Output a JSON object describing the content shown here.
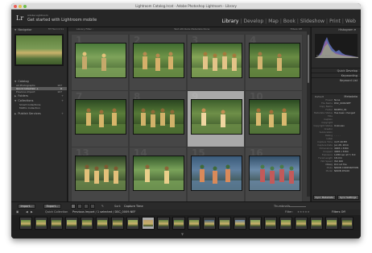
{
  "window": {
    "title": "Lightroom Catalog.lrcat - Adobe Photoshop Lightroom - Library",
    "traffic_colors": [
      "#ec5f57",
      "#e2c14c",
      "#6fbe4a"
    ]
  },
  "identity": {
    "logo": "Lr",
    "small_text": "Adobe Lightroom",
    "big_text": "Get started with Lightroom mobile"
  },
  "modules": [
    {
      "label": "Library",
      "active": true
    },
    {
      "label": "Develop",
      "active": false
    },
    {
      "label": "Map",
      "active": false
    },
    {
      "label": "Book",
      "active": false
    },
    {
      "label": "Slideshow",
      "active": false
    },
    {
      "label": "Print",
      "active": false
    },
    {
      "label": "Web",
      "active": false
    }
  ],
  "left_panel": {
    "navigator_label": "Navigator",
    "navigator_zoom": "FIT  FILL  1:1  3:1",
    "catalog_label": "Catalog",
    "catalog_items": [
      {
        "label": "All Photographs",
        "count": "107",
        "selected": false
      },
      {
        "label": "Quick Collection +",
        "count": "0",
        "selected": true
      },
      {
        "label": "Previous Import",
        "count": "107",
        "selected": false
      }
    ],
    "folders_label": "Folders",
    "collections_label": "Collections",
    "collection_items": [
      {
        "label": "Smart Collections"
      },
      {
        "label": "MoPho Collection"
      }
    ],
    "publish_label": "Publish Services"
  },
  "grid": {
    "header": {
      "left": "Library Filter :",
      "middle": "Text   Attribute   Metadata   None",
      "right": "Filters Off"
    },
    "cells": [
      {
        "num": "1",
        "selected": false,
        "tone": "a"
      },
      {
        "num": "2",
        "selected": false,
        "tone": "b"
      },
      {
        "num": "3",
        "selected": false,
        "tone": "c"
      },
      {
        "num": "4",
        "selected": false,
        "tone": "d"
      },
      {
        "num": "7",
        "selected": false,
        "tone": "e"
      },
      {
        "num": "8",
        "selected": false,
        "tone": "f"
      },
      {
        "num": "9",
        "selected": true,
        "tone": "g"
      },
      {
        "num": "10",
        "selected": false,
        "tone": "h"
      },
      {
        "num": "13",
        "selected": false,
        "tone": "i"
      },
      {
        "num": "14",
        "selected": false,
        "tone": "j"
      },
      {
        "num": "15",
        "selected": false,
        "tone": "k"
      },
      {
        "num": "16",
        "selected": false,
        "tone": "l"
      }
    ]
  },
  "toolbar": {
    "import_label": "Import...",
    "export_label": "Export...",
    "sort_label": "Sort:",
    "sort_value": "Capture Time",
    "thumbnails_label": "Thumbnails"
  },
  "filmbar": {
    "quick_collection": "Quick Collection",
    "path": "Previous Import / 1 selected / DSC_0009.NEF",
    "filter_label": "Filter:",
    "filter_value": "Filters Off"
  },
  "right_panel": {
    "histogram_label": "Histogram",
    "original_photo": "Original Photo",
    "quick_develop_label": "Quick Develop",
    "keywording_label": "Keywording",
    "keyword_list_label": "Keyword List",
    "metadata_label": "Metadata",
    "metadata_preset": "Default",
    "metadata_rows": [
      {
        "k": "Preset",
        "v": "None"
      },
      {
        "k": "File Name",
        "v": "DSC_0009.NEF"
      },
      {
        "k": "Copy Name",
        "v": ""
      },
      {
        "k": "Folder",
        "v": "MOPHO_01"
      },
      {
        "k": "Metadata Status",
        "v": "Has been changed"
      },
      {
        "k": "Title",
        "v": ""
      },
      {
        "k": "Caption",
        "v": ""
      },
      {
        "k": "Copyright",
        "v": ""
      },
      {
        "k": "Copyright Status",
        "v": "Unknown"
      },
      {
        "k": "Creator",
        "v": ""
      },
      {
        "k": "Sublocation",
        "v": ""
      },
      {
        "k": "Rating",
        "v": "· · · · ·"
      },
      {
        "k": "Label",
        "v": ""
      },
      {
        "k": "Capture Time",
        "v": "4:27:49 PM"
      },
      {
        "k": "Capture Date",
        "v": "Jun 28, 2014"
      },
      {
        "k": "Dimensions",
        "v": "4928 x 3264"
      },
      {
        "k": "Cropped",
        "v": "4928 x 3264"
      },
      {
        "k": "Exposure",
        "v": "1/250 sec at f / 8.0"
      },
      {
        "k": "Focal Length",
        "v": "18 mm"
      },
      {
        "k": "ISO Speed Rating",
        "v": "ISO 400"
      },
      {
        "k": "Flash",
        "v": "Did not fire"
      },
      {
        "k": "Make",
        "v": "NIKON CORPORATION"
      },
      {
        "k": "Model",
        "v": "NIKON D5100"
      }
    ],
    "sync_metadata": "Sync Metadata",
    "sync_settings": "Sync Settings"
  },
  "filmstrip": {
    "count": 22,
    "selected_index": 8
  }
}
